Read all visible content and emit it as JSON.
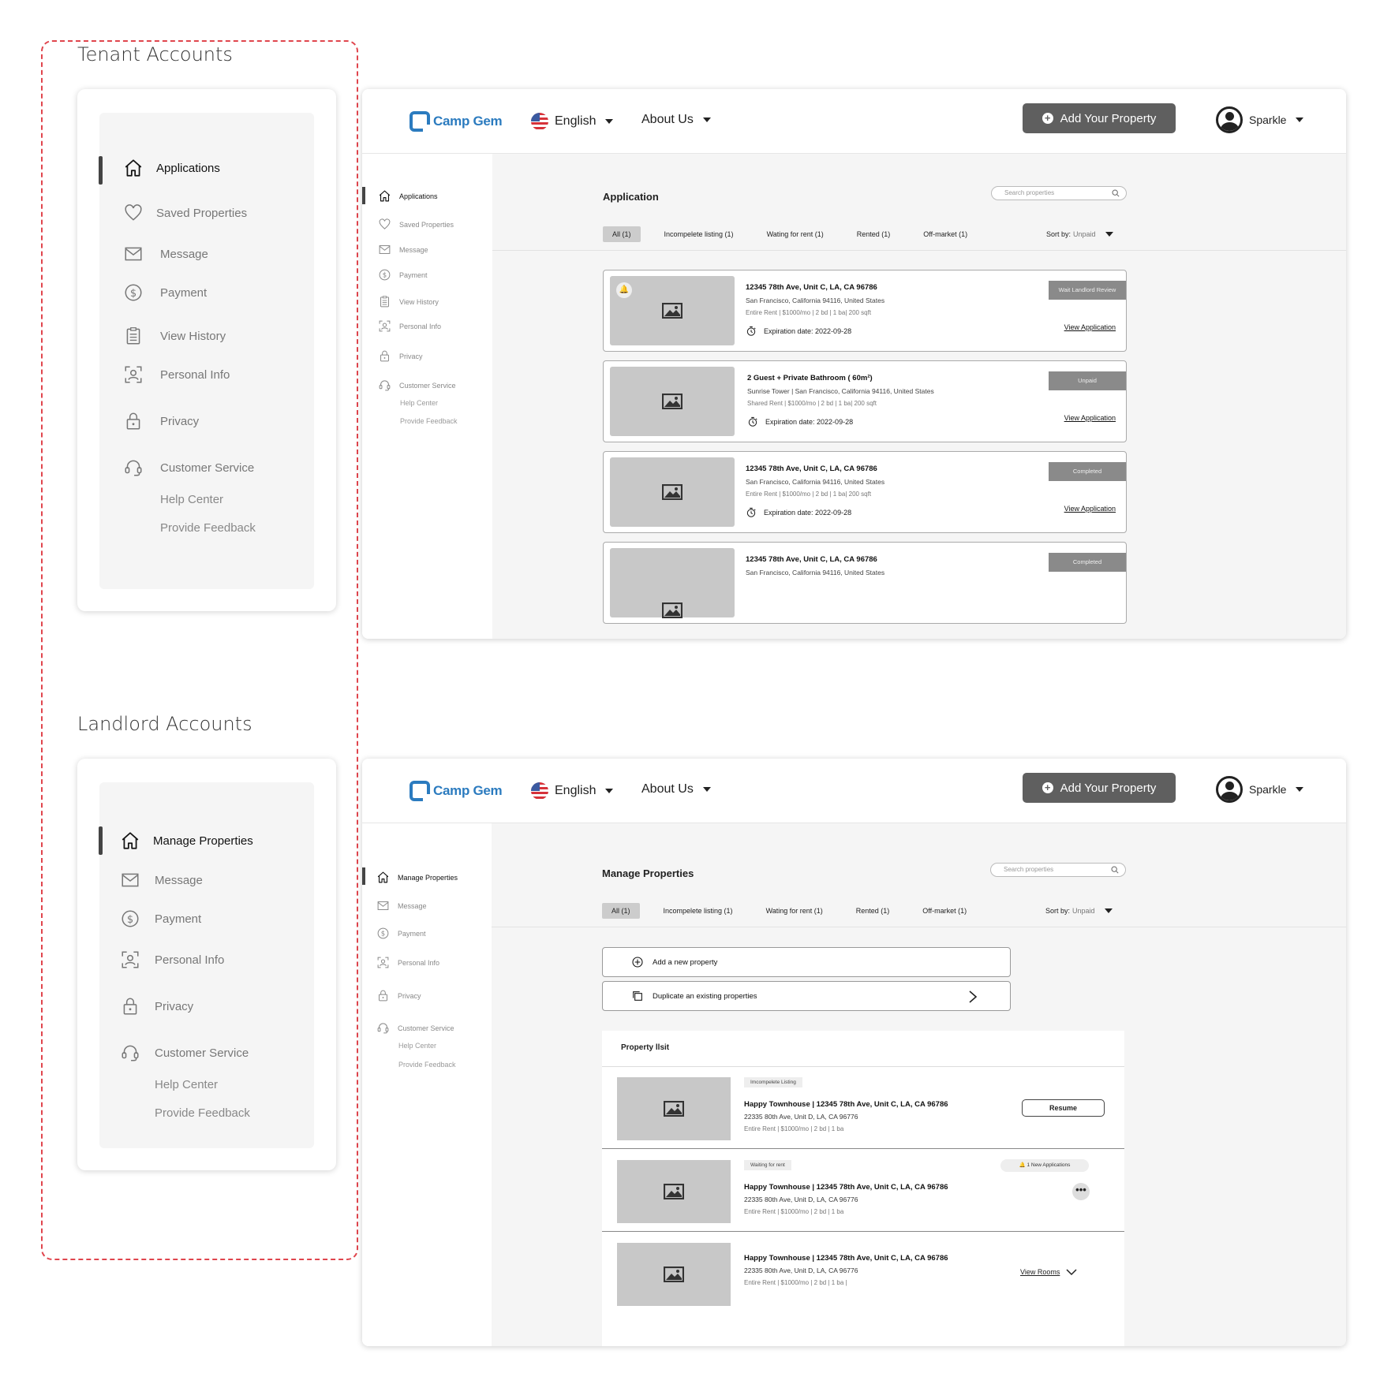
{
  "tenant": {
    "section_title": "Tenant Accounts",
    "nav": [
      {
        "label": "Applications",
        "icon": "home-icon"
      },
      {
        "label": "Saved Properties",
        "icon": "heart-icon"
      },
      {
        "label": "Message",
        "icon": "mail-icon"
      },
      {
        "label": "Payment",
        "icon": "dollar-icon"
      },
      {
        "label": "View History",
        "icon": "clipboard-icon"
      },
      {
        "label": "Personal Info",
        "icon": "person-scan-icon"
      },
      {
        "label": "Privacy",
        "icon": "lock-icon"
      },
      {
        "label": "Customer Service",
        "icon": "headset-icon"
      },
      {
        "label": "Help Center"
      },
      {
        "label": "Provide Feedback"
      }
    ],
    "screen": {
      "title": "Application",
      "search_placeholder": "Search properties",
      "tabs": [
        "All  (1)",
        "Incompelete listing  (1)",
        "Wating for rent  (1)",
        "Rented  (1)",
        "Off-market  (1)"
      ],
      "sort_label": "Sort by:",
      "sort_value": "Unpaid",
      "applications": [
        {
          "title": "12345 78th Ave, Unit C, LA, CA 96786",
          "line1": "San Francisco, California 94116, United States",
          "line2": "Entire Rent | $1000/mo | 2 bd | 1 ba| 200 sqft",
          "expiration": "Expiration date: 2022-09-28",
          "status": "Wait Landlord Review",
          "action": "View Application"
        },
        {
          "title": "2 Guest  + Private Bathroom ( 60m²)",
          "line1": "Sunrise Tower | San Francisco, California 94116, United States",
          "line2": "Shared Rent | $1000/mo | 2 bd | 1 ba| 200 sqft",
          "expiration": "Expiration date: 2022-09-28",
          "status": "Unpaid",
          "action": "View Application"
        },
        {
          "title": "12345 78th Ave, Unit C, LA, CA 96786",
          "line1": "San Francisco, California 94116, United States",
          "line2": "Entire Rent | $1000/mo | 2 bd | 1 ba| 200 sqft",
          "expiration": "Expiration date: 2022-09-28",
          "status": "Completed",
          "action": "View Application"
        },
        {
          "title": "12345 78th Ave, Unit C, LA, CA 96786",
          "line1": "San Francisco, California 94116, United States",
          "status": "Completed"
        }
      ]
    }
  },
  "landlord": {
    "section_title": "Landlord Accounts",
    "nav": [
      {
        "label": "Manage Properties",
        "icon": "home-icon"
      },
      {
        "label": "Message",
        "icon": "mail-icon"
      },
      {
        "label": "Payment",
        "icon": "dollar-icon"
      },
      {
        "label": "Personal Info",
        "icon": "person-scan-icon"
      },
      {
        "label": "Privacy",
        "icon": "lock-icon"
      },
      {
        "label": "Customer Service",
        "icon": "headset-icon"
      },
      {
        "label": "Help Center"
      },
      {
        "label": "Provide Feedback"
      }
    ],
    "screen": {
      "title": "Manage Properties",
      "search_placeholder": "Search properties",
      "tabs": [
        "All  (1)",
        "Incompelete listing  (1)",
        "Wating for rent  (1)",
        "Rented  (1)",
        "Off-market  (1)"
      ],
      "sort_label": "Sort by:",
      "sort_value": "Unpaid",
      "add_new": "Add a new property",
      "duplicate": "Duplicate an existing properties",
      "list_title": "Property llsit",
      "properties": [
        {
          "tag": "Imcompelete Listing",
          "title": "Happy Townhouse | 12345 78th Ave, Unit C, LA, CA 96786",
          "line1": "22335 80th Ave, Unit D, LA, CA 96776",
          "line2": "Entire Rent | $1000/mo | 2 bd | 1 ba",
          "action": "Resume"
        },
        {
          "tag": "Waiting for rent",
          "title": "Happy Townhouse | 12345 78th Ave, Unit C, LA, CA 96786",
          "line1": "22335 80th Ave, Unit D, LA, CA 96776",
          "line2": "Entire Rent | $1000/mo | 2 bd | 1 ba",
          "badge": "1 New Applications",
          "more": "•••"
        },
        {
          "title": "Happy Townhouse | 12345 78th Ave, Unit C, LA, CA 96786",
          "line1": "22335 80th Ave, Unit D, LA, CA 96776",
          "line2": "Entire Rent | $1000/mo | 2 bd | 1 ba |",
          "action": "View Rooms"
        }
      ]
    }
  },
  "header": {
    "brand": "Camp Gem",
    "language": "English",
    "about": "About Us",
    "add_property": "Add Your Property",
    "user": "Sparkle"
  }
}
